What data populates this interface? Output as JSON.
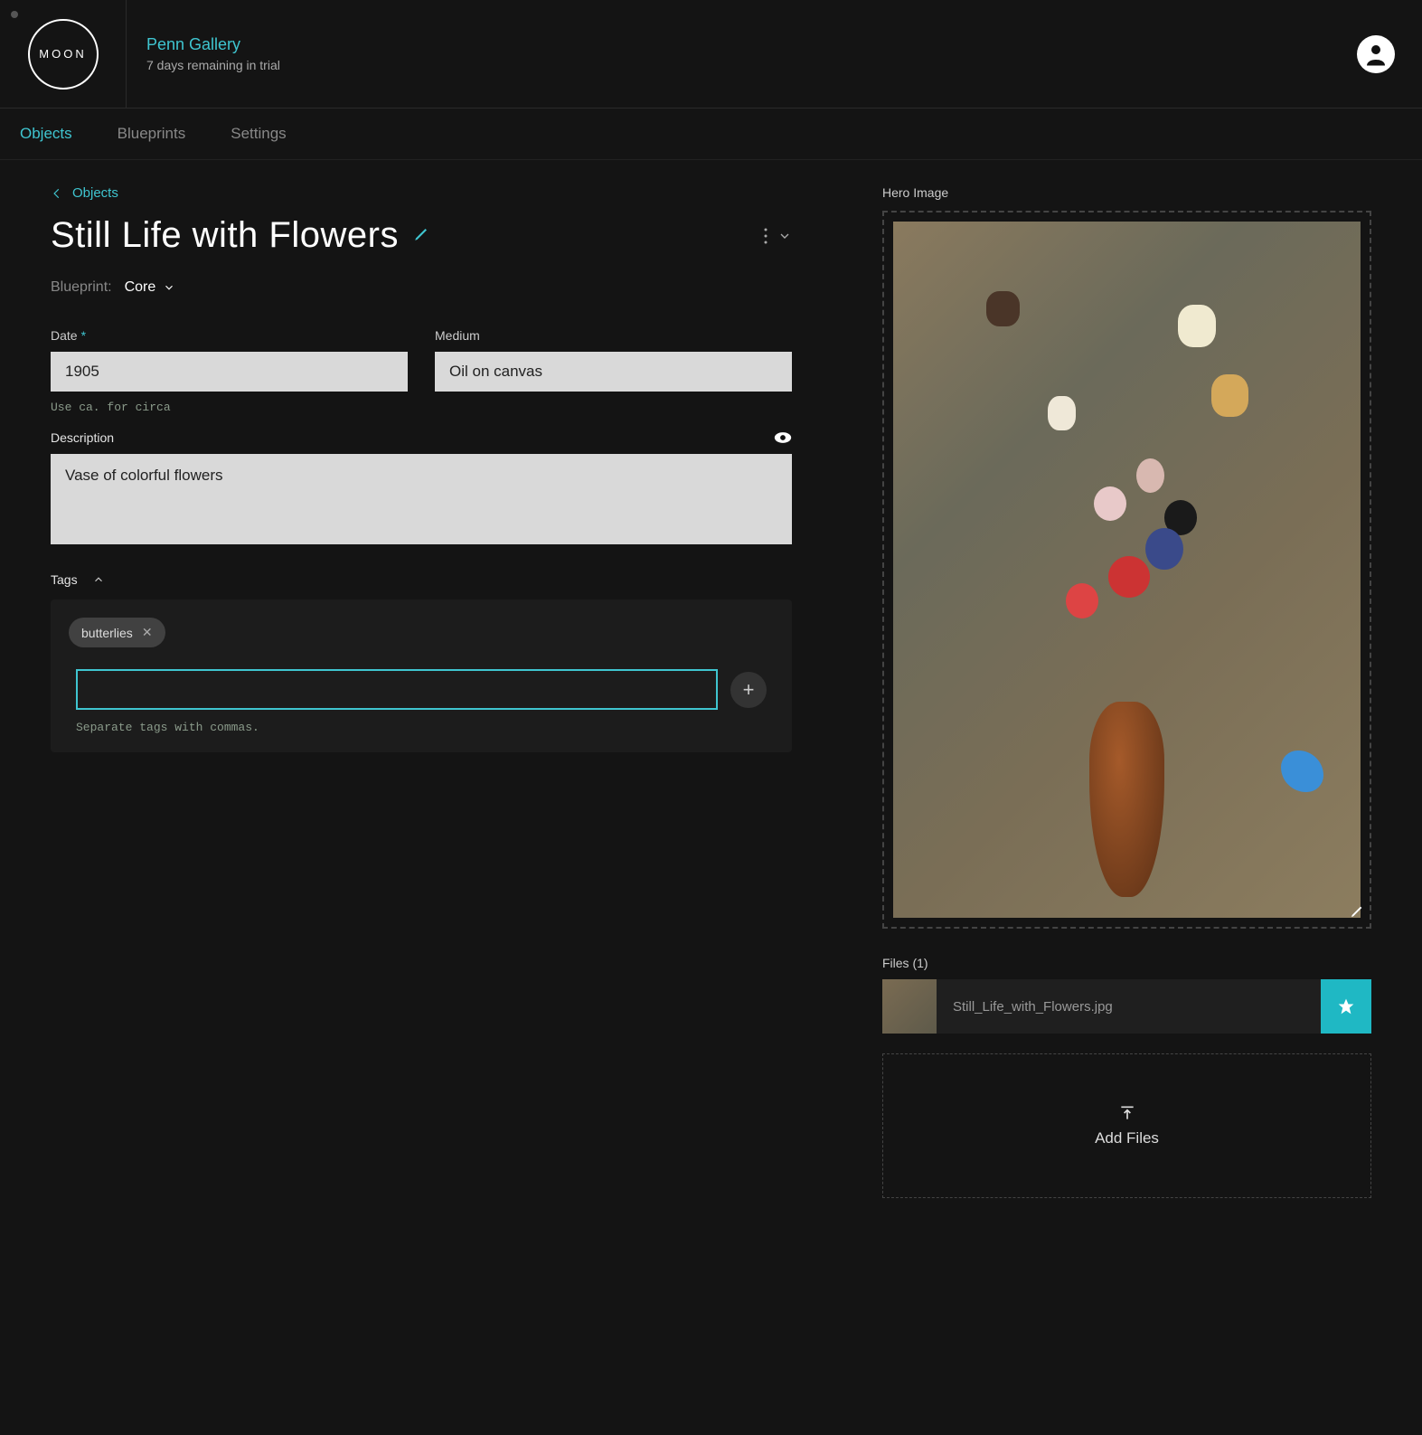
{
  "header": {
    "logo_text": "MOON",
    "gallery_name": "Penn Gallery",
    "trial_text": "7 days remaining in trial"
  },
  "nav": {
    "items": [
      "Objects",
      "Blueprints",
      "Settings"
    ],
    "active_index": 0
  },
  "breadcrumb": {
    "label": "Objects"
  },
  "page": {
    "title": "Still Life with Flowers"
  },
  "blueprint": {
    "label": "Blueprint:",
    "value": "Core"
  },
  "fields": {
    "date": {
      "label": "Date",
      "value": "1905",
      "hint": "Use ca. for circa"
    },
    "medium": {
      "label": "Medium",
      "value": "Oil on canvas"
    },
    "description": {
      "label": "Description",
      "value": "Vase of colorful flowers"
    }
  },
  "tags": {
    "label": "Tags",
    "items": [
      "butterlies"
    ],
    "input_value": "",
    "hint": "Separate tags with commas."
  },
  "hero": {
    "label": "Hero Image"
  },
  "files": {
    "label": "Files (1)",
    "items": [
      {
        "name": "Still_Life_with_Flowers.jpg",
        "starred": true
      }
    ],
    "add_label": "Add Files"
  },
  "colors": {
    "accent": "#3fc5d0",
    "star_bg": "#1fb8c4"
  }
}
